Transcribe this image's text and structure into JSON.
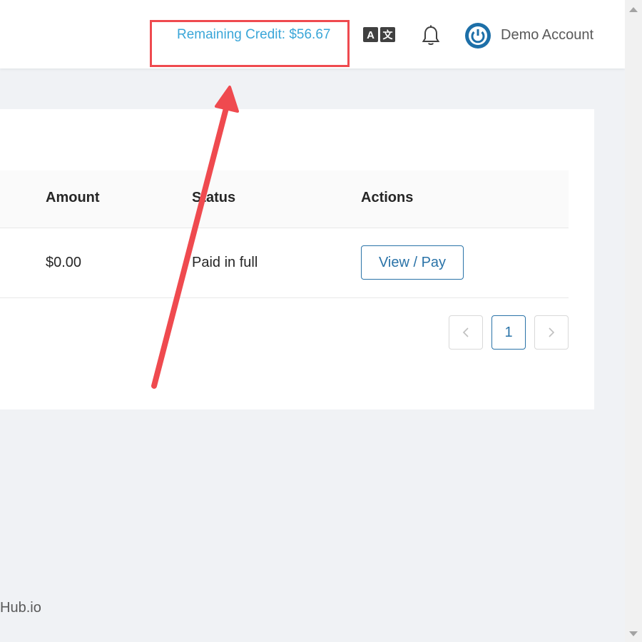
{
  "header": {
    "remaining_credit": "Remaining Credit: $56.67",
    "account_name": "Demo Account",
    "language_icon": "translate-icon",
    "notification_icon": "bell-icon",
    "avatar_icon": "power-icon"
  },
  "table": {
    "columns": [
      "Amount",
      "Status",
      "Actions"
    ],
    "rows": [
      {
        "amount": "$0.00",
        "status": "Paid in full",
        "action": "View / Pay"
      }
    ]
  },
  "pagination": {
    "prev_icon": "chevron-left-icon",
    "current_page": "1",
    "next_icon": "chevron-right-icon"
  },
  "footer": {
    "text": "Hub.io"
  },
  "colors": {
    "accent": "#2a73a8",
    "credit": "#3aa6d8",
    "annotation": "#ef4a4f",
    "background": "#f0f2f5"
  }
}
